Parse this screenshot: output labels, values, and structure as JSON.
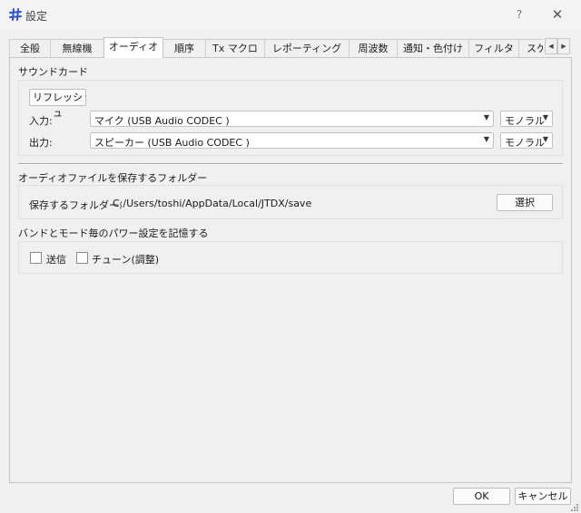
{
  "window": {
    "title": "設定",
    "help_label": "?",
    "close_label": "✕",
    "icon": "app-icon"
  },
  "tabs": [
    {
      "label": "全般",
      "active": false
    },
    {
      "label": "無線機",
      "active": false
    },
    {
      "label": "オーディオ",
      "active": true
    },
    {
      "label": "順序",
      "active": false
    },
    {
      "label": "Tx マクロ",
      "active": false
    },
    {
      "label": "レポーティング",
      "active": false
    },
    {
      "label": "周波数",
      "active": false
    },
    {
      "label": "通知・色付け",
      "active": false
    },
    {
      "label": "フィルタ",
      "active": false
    },
    {
      "label": "スケ",
      "active": false
    }
  ],
  "tab_scroll": {
    "left": "◀",
    "right": "▶"
  },
  "soundcard": {
    "title": "サウンドカード",
    "refresh_label": "リフレッシュ",
    "input_label": "入力:",
    "input_device": "マイク (USB Audio CODEC )",
    "input_channel": "モノラル",
    "output_label": "出力:",
    "output_device": "スピーカー (USB Audio CODEC )",
    "output_channel": "モノラル"
  },
  "save_folder": {
    "title": "オーディオファイルを保存するフォルダー",
    "label": "保存するフォルダー:",
    "path": "C:/Users/toshi/AppData/Local/JTDX/save",
    "select_label": "選択"
  },
  "band_power": {
    "title": "バンドとモード毎のパワー設定を記憶する",
    "transmit_label": "送信",
    "transmit_checked": false,
    "tune_label": "チューン(調整)",
    "tune_checked": false
  },
  "footer": {
    "ok_label": "OK",
    "cancel_label": "キャンセル"
  },
  "colors": {
    "accent": "#3b5bdb",
    "window_bg": "#f0f0f0"
  }
}
